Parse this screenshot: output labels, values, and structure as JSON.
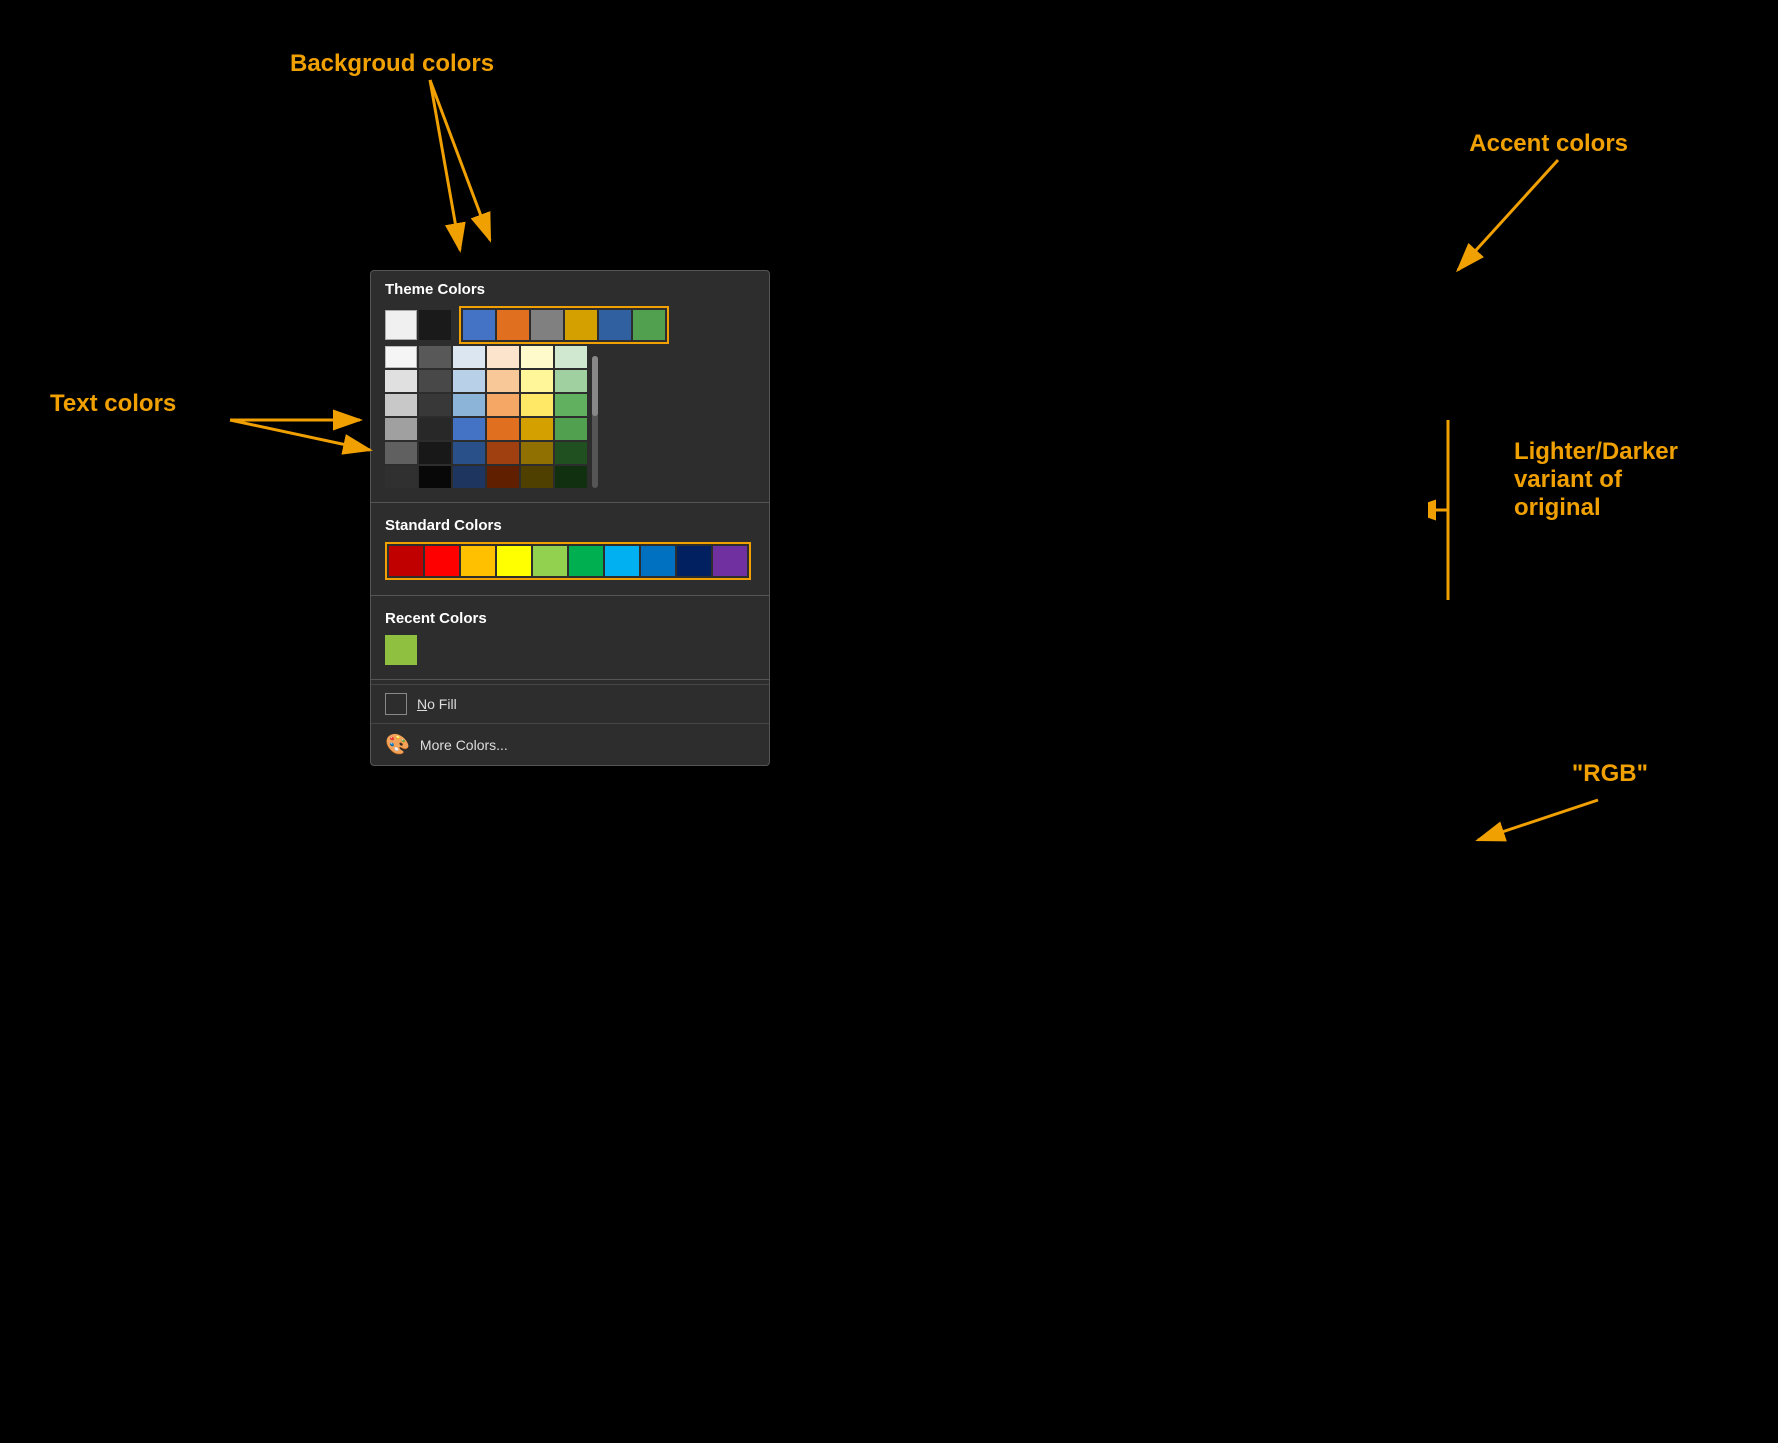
{
  "background": "#000000",
  "annotations": {
    "background_colors_label": "Backgroud colors",
    "accent_colors_label": "Accent colors",
    "text_colors_label": "Text colors",
    "lighter_darker_label": "Lighter/Darker\nvariant of\noriginal",
    "rgb_label": "\"RGB\"",
    "arrow_color": "#f0a000"
  },
  "panel": {
    "theme_section": {
      "title": "Theme Colors",
      "text_colors": [
        {
          "color": "#f0f0f0"
        },
        {
          "color": "#1a1a1a"
        }
      ],
      "accent_colors": [
        {
          "color": "#4472c4"
        },
        {
          "color": "#e07020"
        },
        {
          "color": "#808080"
        },
        {
          "color": "#d4a000"
        },
        {
          "color": "#3060a0"
        },
        {
          "color": "#50a050"
        }
      ],
      "variant_columns": [
        [
          "#f5f5f5",
          "#e0e0e0",
          "#c8c8c8",
          "#a0a0a0",
          "#606060",
          "#303030"
        ],
        [
          "#404040",
          "#555555",
          "#686868",
          "#808080",
          "#9a9a9a",
          "#1a1a1a"
        ],
        [
          "#dce6f1",
          "#b8d0e8",
          "#8bb4d8",
          "#5890c0",
          "#366090",
          "#1e3d60"
        ],
        [
          "#fce4cc",
          "#f9c899",
          "#f5a866",
          "#e07020",
          "#a04010",
          "#602000"
        ],
        [
          "#fffacc",
          "#fff599",
          "#ffe866",
          "#d4a000",
          "#907000",
          "#504000"
        ],
        [
          "#d0e8d0",
          "#a0d0a0",
          "#60b060",
          "#408040",
          "#205020",
          "#103010"
        ]
      ]
    },
    "standard_section": {
      "title": "Standard Colors",
      "colors": [
        "#c00000",
        "#ff0000",
        "#ffc000",
        "#ffff00",
        "#92d050",
        "#00b050",
        "#00b0f0",
        "#0070c0",
        "#002060",
        "#7030a0"
      ]
    },
    "recent_section": {
      "title": "Recent Colors",
      "colors": [
        "#90c040"
      ]
    },
    "no_fill": {
      "label": "No Fill",
      "underline_char": "N"
    },
    "more_colors": {
      "label": "More Colors..."
    }
  }
}
